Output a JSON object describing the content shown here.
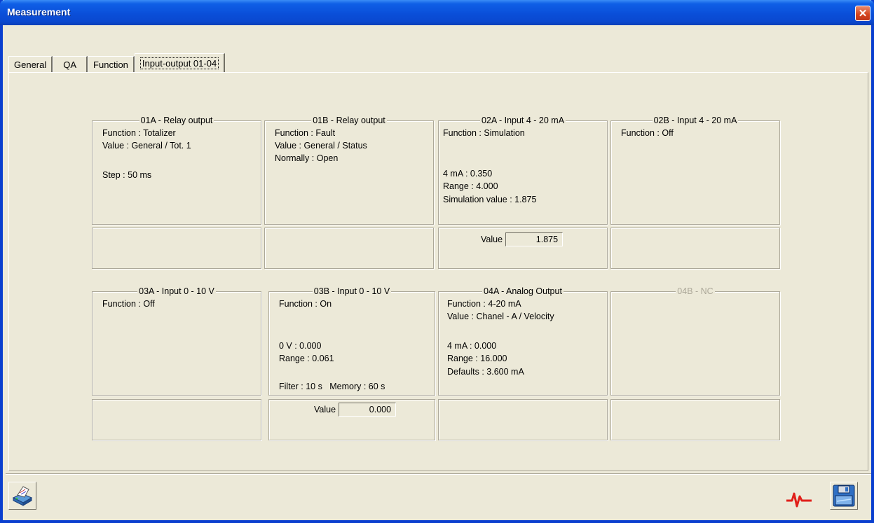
{
  "window": {
    "title": "Measurement",
    "close_glyph": "✕"
  },
  "tabs": [
    {
      "label": "General"
    },
    {
      "label": "QA"
    },
    {
      "label": "Function"
    },
    {
      "label": "Input-output 01-04"
    }
  ],
  "active_tab_index": 3,
  "channels": {
    "c01a": {
      "title": "01A - Relay output",
      "lines": [
        "Function : Totalizer",
        "Value : General / Tot. 1",
        "",
        "Step : 50 ms"
      ]
    },
    "c01b": {
      "title": "01B - Relay output",
      "lines": [
        "Function : Fault",
        "Value : General / Status",
        "Normally : Open"
      ]
    },
    "c02a": {
      "title": "02A - Input 4 - 20 mA",
      "lines": [
        "Function : Simulation",
        "4 mA : 0.350",
        "Range : 4.000",
        "Simulation value : 1.875"
      ],
      "value_label": "Value",
      "value": "1.875"
    },
    "c02b": {
      "title": "02B - Input 4 - 20 mA",
      "lines": [
        "Function : Off"
      ]
    },
    "c03a": {
      "title": "03A - Input 0 - 10 V",
      "lines": [
        "Function : Off"
      ]
    },
    "c03b": {
      "title": "03B - Input 0 - 10 V",
      "lines": [
        "Function : On",
        "0 V : 0.000",
        "Range : 0.061",
        "Filter : 10 s   Memory : 60 s"
      ],
      "value_label": "Value",
      "value": "0.000"
    },
    "c04a": {
      "title": "04A - Analog Output",
      "lines": [
        "Function : 4-20 mA",
        "Value : Chanel - A / Velocity",
        "4 mA : 0.000",
        "Range : 16.000",
        "Defaults : 3.600 mA"
      ]
    },
    "c04b": {
      "title": "04B - NC",
      "lines": []
    }
  },
  "icons": {
    "print": "printer-icon",
    "signal": "waveform-icon",
    "save": "floppy-disk-icon"
  },
  "colors": {
    "title_bar": "#0a4fd9",
    "background": "#ece9d8",
    "signal": "#e0201a"
  }
}
